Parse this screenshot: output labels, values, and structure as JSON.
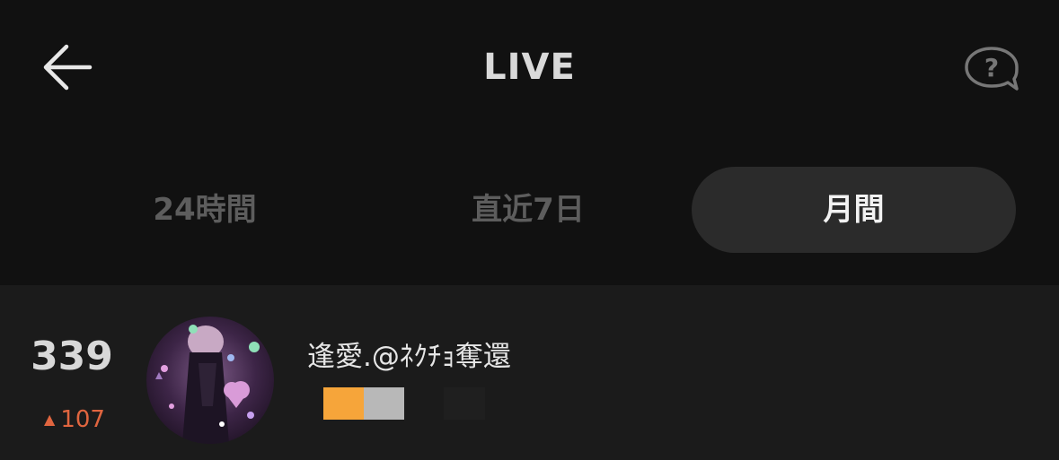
{
  "header": {
    "title": "LIVE",
    "back_icon": "arrow-left-icon",
    "help_icon": "question-bubble-icon"
  },
  "tabs": [
    {
      "label": "24時間",
      "active": false
    },
    {
      "label": "直近7日",
      "active": false
    },
    {
      "label": "月間",
      "active": true
    }
  ],
  "ranking": {
    "rank": "339",
    "change": "107",
    "change_direction": "up",
    "user_name": "逢愛.@ﾈｸﾁｮ奪還",
    "badge_colors": [
      "#f6a53a",
      "#b8b8b8",
      "#1f1f1f"
    ]
  },
  "colors": {
    "background": "#111111",
    "row_background": "#1b1b1b",
    "tab_active_bg": "#2b2b2b",
    "rank_up": "#e0653f"
  }
}
